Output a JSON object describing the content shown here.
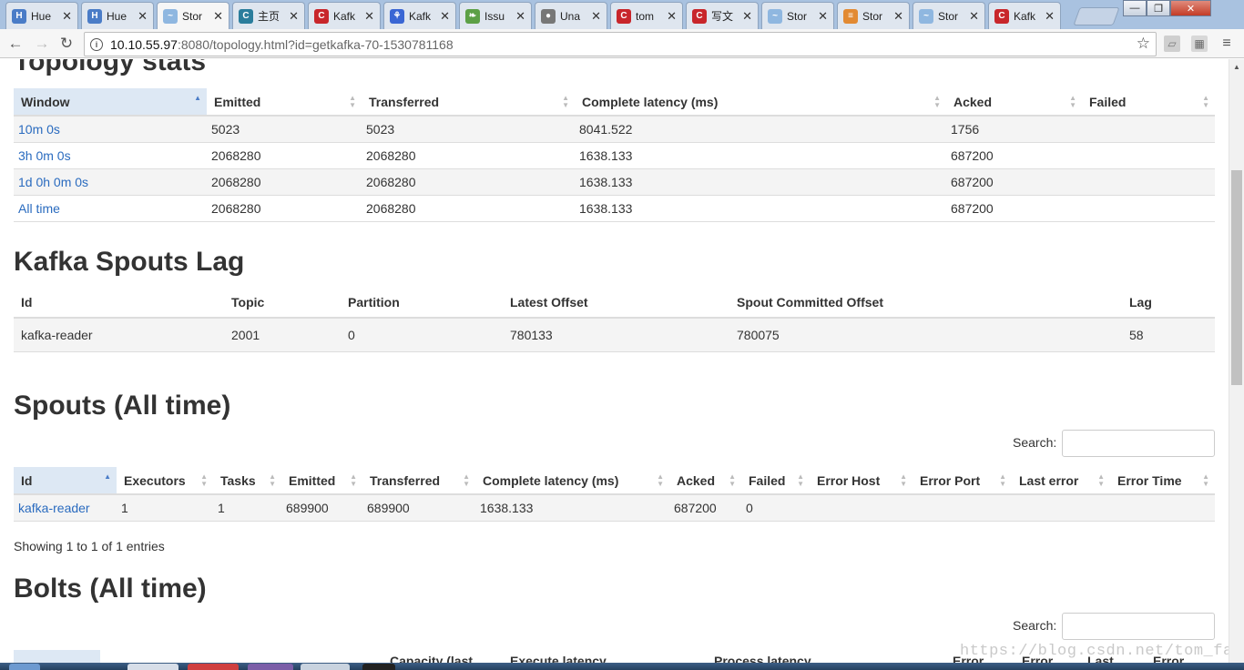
{
  "browser": {
    "tabs": [
      {
        "title": "Hue",
        "favicon": "hue-icon",
        "color": "#4a7cc7",
        "glyph": "H",
        "active": false
      },
      {
        "title": "Hue",
        "favicon": "hue-icon",
        "color": "#4a7cc7",
        "glyph": "H",
        "active": false
      },
      {
        "title": "Stor",
        "favicon": "storm-icon",
        "color": "#8fb7e0",
        "glyph": "~",
        "active": true
      },
      {
        "title": "主页",
        "favicon": "cnblogs-icon",
        "color": "#2a7d9c",
        "glyph": "C",
        "active": false
      },
      {
        "title": "Kafk",
        "favicon": "csdn-icon",
        "color": "#c8262b",
        "glyph": "C",
        "active": false
      },
      {
        "title": "Kafk",
        "favicon": "baidu-icon",
        "color": "#3a66d4",
        "glyph": "⚘",
        "active": false
      },
      {
        "title": "Issu",
        "favicon": "github-leaf-icon",
        "color": "#5ca046",
        "glyph": "❧",
        "active": false
      },
      {
        "title": "Una",
        "favicon": "github-icon",
        "color": "#777777",
        "glyph": "●",
        "active": false
      },
      {
        "title": "tom",
        "favicon": "csdn-icon",
        "color": "#c8262b",
        "glyph": "C",
        "active": false
      },
      {
        "title": "写文",
        "favicon": "csdn-icon",
        "color": "#c8262b",
        "glyph": "C",
        "active": false
      },
      {
        "title": "Stor",
        "favicon": "storm-icon",
        "color": "#8fb7e0",
        "glyph": "~",
        "active": false
      },
      {
        "title": "Stor",
        "favicon": "stackoverflow-icon",
        "color": "#e28a33",
        "glyph": "≡",
        "active": false
      },
      {
        "title": "Stor",
        "favicon": "storm-icon",
        "color": "#8fb7e0",
        "glyph": "~",
        "active": false
      },
      {
        "title": "Kafk",
        "favicon": "csdn-icon",
        "color": "#c8262b",
        "glyph": "C",
        "active": false
      }
    ],
    "tab_close_glyph": "✕",
    "window_buttons": {
      "minimize": "—",
      "maximize": "❐",
      "close": "✕"
    },
    "url_host": "10.10.55.97",
    "url_rest": ":8080/topology.html?id=getkafka-70-1530781168"
  },
  "topology_stats": {
    "title": "Topology stats",
    "columns": [
      "Window",
      "Emitted",
      "Transferred",
      "Complete latency (ms)",
      "Acked",
      "Failed"
    ],
    "rows": [
      {
        "window": "10m 0s",
        "emitted": "5023",
        "transferred": "5023",
        "latency": "8041.522",
        "acked": "1756",
        "failed": ""
      },
      {
        "window": "3h 0m 0s",
        "emitted": "2068280",
        "transferred": "2068280",
        "latency": "1638.133",
        "acked": "687200",
        "failed": ""
      },
      {
        "window": "1d 0h 0m 0s",
        "emitted": "2068280",
        "transferred": "2068280",
        "latency": "1638.133",
        "acked": "687200",
        "failed": ""
      },
      {
        "window": "All time",
        "emitted": "2068280",
        "transferred": "2068280",
        "latency": "1638.133",
        "acked": "687200",
        "failed": ""
      }
    ]
  },
  "kafka_lag": {
    "title": "Kafka Spouts Lag",
    "columns": [
      "Id",
      "Topic",
      "Partition",
      "Latest Offset",
      "Spout Committed Offset",
      "Lag"
    ],
    "rows": [
      {
        "id": "kafka-reader",
        "topic": "2001",
        "partition": "0",
        "latest": "780133",
        "committed": "780075",
        "lag": "58"
      }
    ]
  },
  "spouts": {
    "title": "Spouts (All time)",
    "search_label": "Search:",
    "columns": [
      "Id",
      "Executors",
      "Tasks",
      "Emitted",
      "Transferred",
      "Complete latency (ms)",
      "Acked",
      "Failed",
      "Error Host",
      "Error Port",
      "Last error",
      "Error Time"
    ],
    "rows": [
      {
        "id": "kafka-reader",
        "executors": "1",
        "tasks": "1",
        "emitted": "689900",
        "transferred": "689900",
        "latency": "1638.133",
        "acked": "687200",
        "failed": "0",
        "error_host": "",
        "error_port": "",
        "last_error": "",
        "error_time": ""
      }
    ],
    "info": "Showing 1 to 1 of 1 entries"
  },
  "bolts": {
    "title": "Bolts (All time)",
    "search_label": "Search:",
    "partial_columns": [
      "Capacity (last",
      "Execute latency",
      "Process latency",
      "Error",
      "Error",
      "Last",
      "Error"
    ]
  },
  "watermark": "https://blog.csdn.net/tom_fans",
  "sort_glyphs": {
    "up": "▲",
    "down": "▼"
  }
}
